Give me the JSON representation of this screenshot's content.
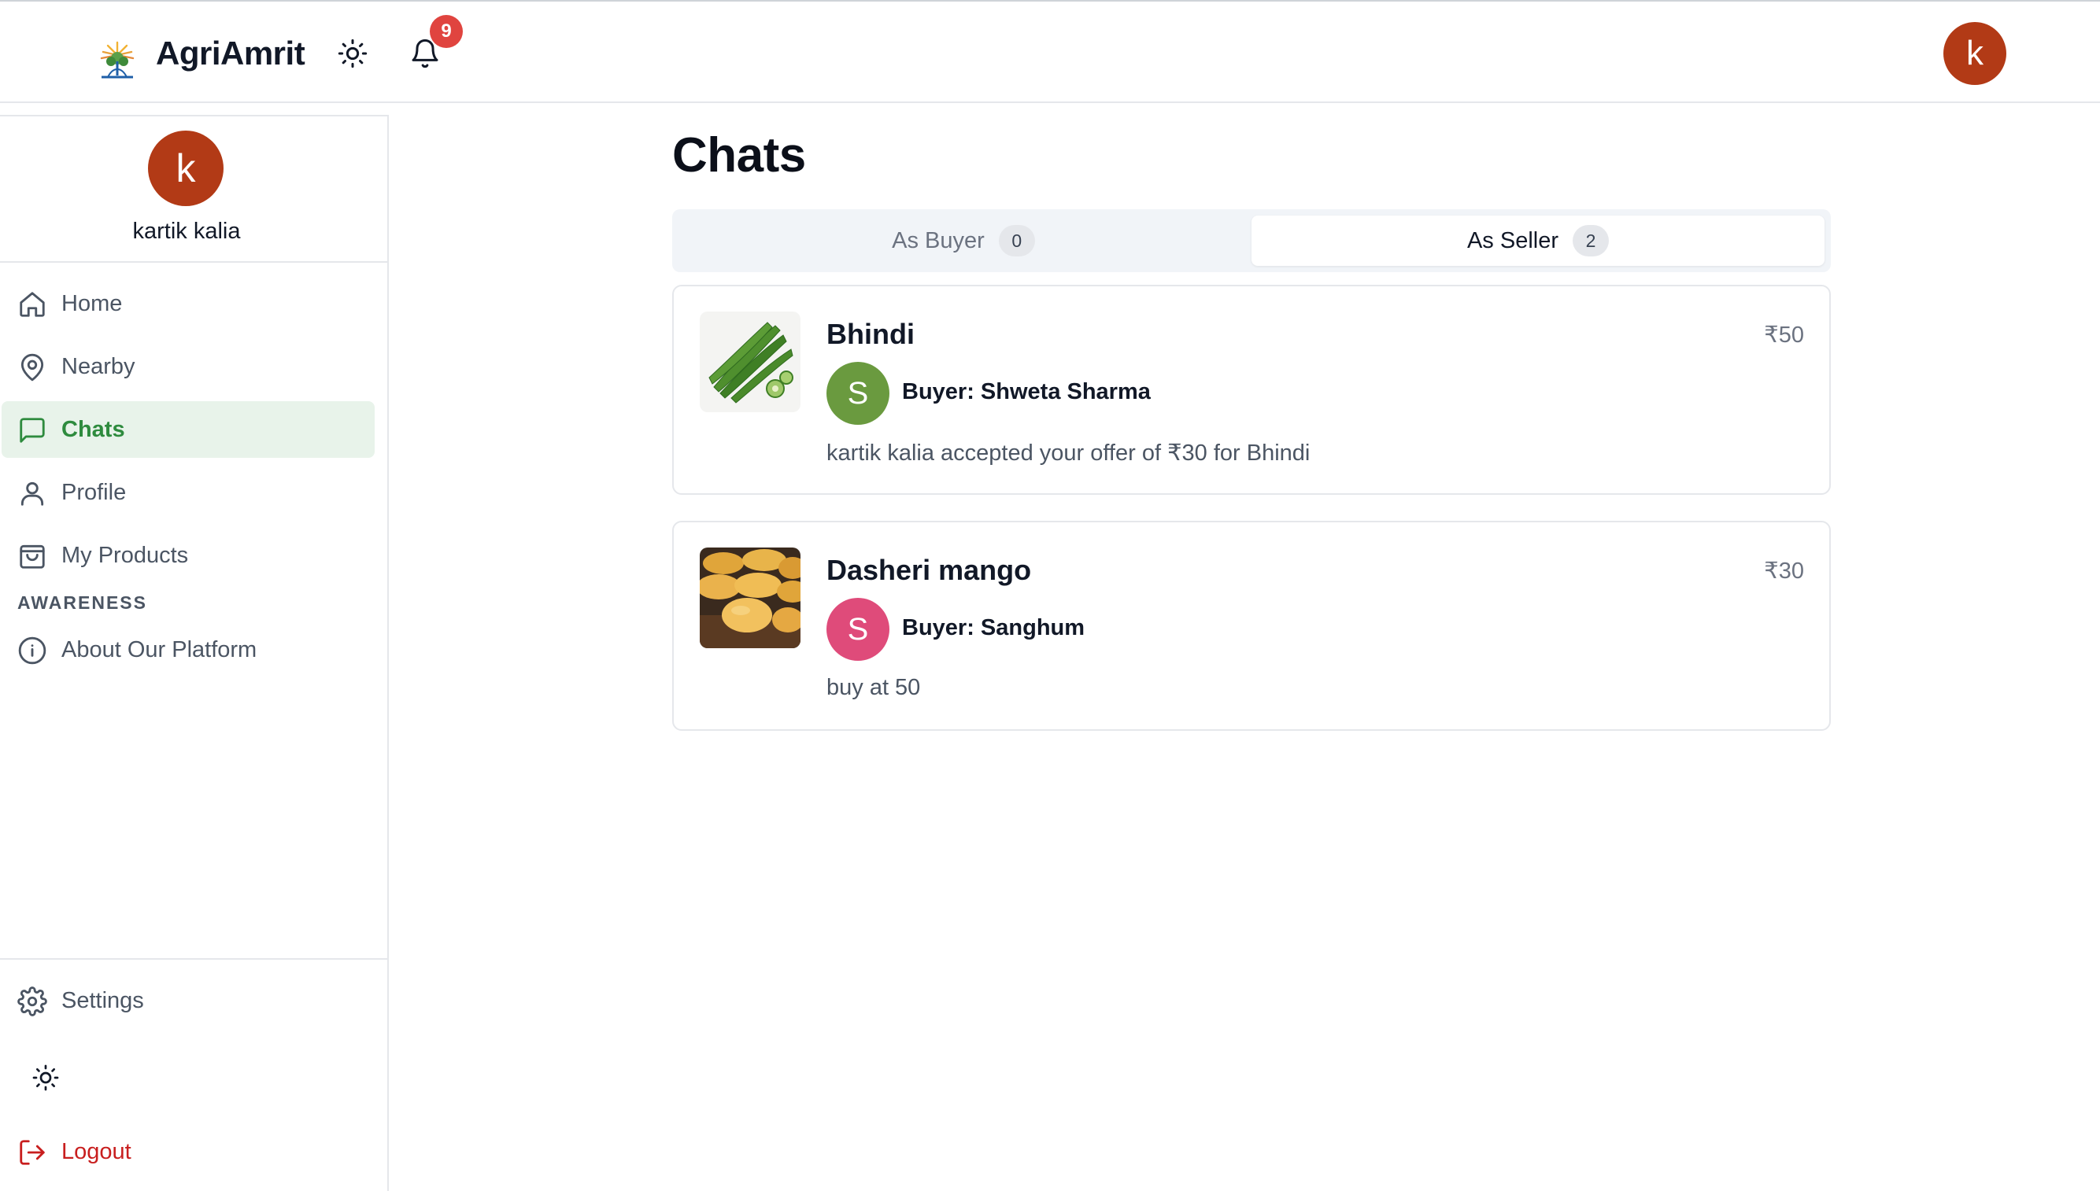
{
  "app": {
    "title": "AgriAmrit",
    "notification_count": "9",
    "user_initial": "k"
  },
  "sidebar": {
    "user_initial": "k",
    "user_name": "kartik kalia",
    "items": [
      {
        "label": "Home",
        "icon": "home-icon"
      },
      {
        "label": "Nearby",
        "icon": "map-pin-icon"
      },
      {
        "label": "Chats",
        "icon": "message-square-icon",
        "active": true
      },
      {
        "label": "Profile",
        "icon": "user-icon"
      },
      {
        "label": "My Products",
        "icon": "shopping-bag-icon"
      }
    ],
    "section_awareness": "AWARENESS",
    "awareness_items": [
      {
        "label": "About Our Platform",
        "icon": "info-icon"
      }
    ],
    "settings_label": "Settings",
    "logout_label": "Logout"
  },
  "main": {
    "title": "Chats",
    "tabs": [
      {
        "label": "As Buyer",
        "count": "0",
        "active": false
      },
      {
        "label": "As Seller",
        "count": "2",
        "active": true
      }
    ],
    "chats": [
      {
        "product": "Bhindi",
        "price": "₹50",
        "buyer_initial": "S",
        "buyer_label": "Buyer: Shweta Sharma",
        "last_message": "kartik kalia accepted your offer of ₹30 for Bhindi"
      },
      {
        "product": "Dasheri mango",
        "price": "₹30",
        "buyer_initial": "S",
        "buyer_label": "Buyer: Sanghum",
        "last_message": "buy at 50"
      }
    ]
  },
  "colors": {
    "accent_green": "#2e8b3e",
    "active_bg": "#e8f3ea",
    "avatar_brown": "#b23a16",
    "badge_red": "#e0443f",
    "buyer1_green": "#6a9a3f",
    "buyer2_pink": "#df4b7a",
    "logout_red": "#c81e1e"
  }
}
